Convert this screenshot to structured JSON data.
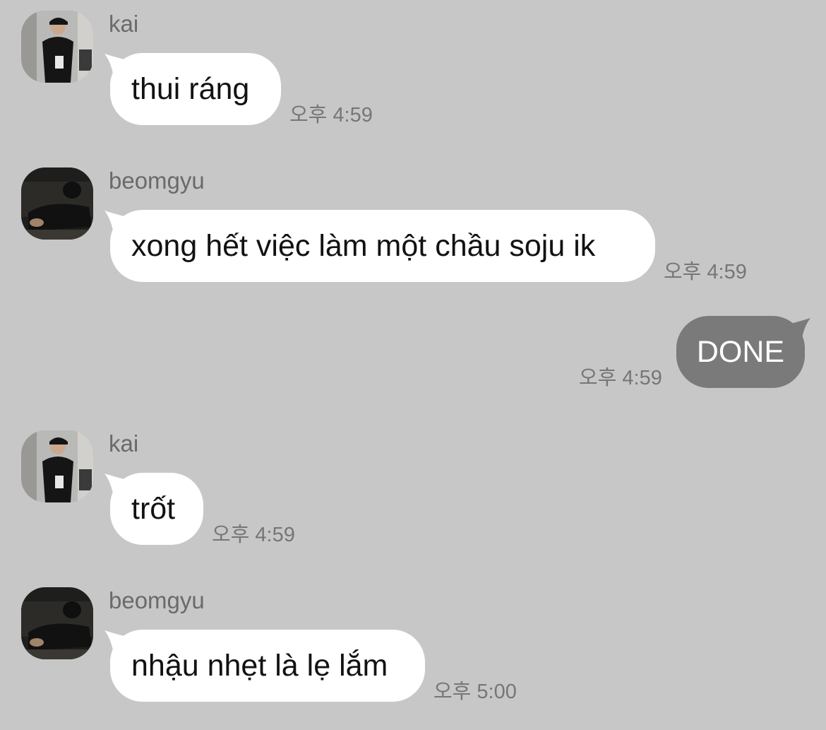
{
  "messages": [
    {
      "sender": "kai",
      "text": "thui ráng",
      "time": "오후 4:59"
    },
    {
      "sender": "beomgyu",
      "text": "xong hết việc làm một chầu soju ik",
      "time": "오후 4:59"
    },
    {
      "text": "DONE",
      "time": "오후 4:59"
    },
    {
      "sender": "kai",
      "text": "trốt",
      "time": "오후 4:59"
    },
    {
      "sender": "beomgyu",
      "text": "nhậu nhẹt là lẹ lắm",
      "time": "오후 5:00"
    }
  ],
  "colors": {
    "background": "#c7c7c7",
    "incoming_bubble": "#ffffff",
    "outgoing_bubble": "#7a7a7a",
    "timestamp": "#767676",
    "sender_name": "#6a6a6a"
  }
}
